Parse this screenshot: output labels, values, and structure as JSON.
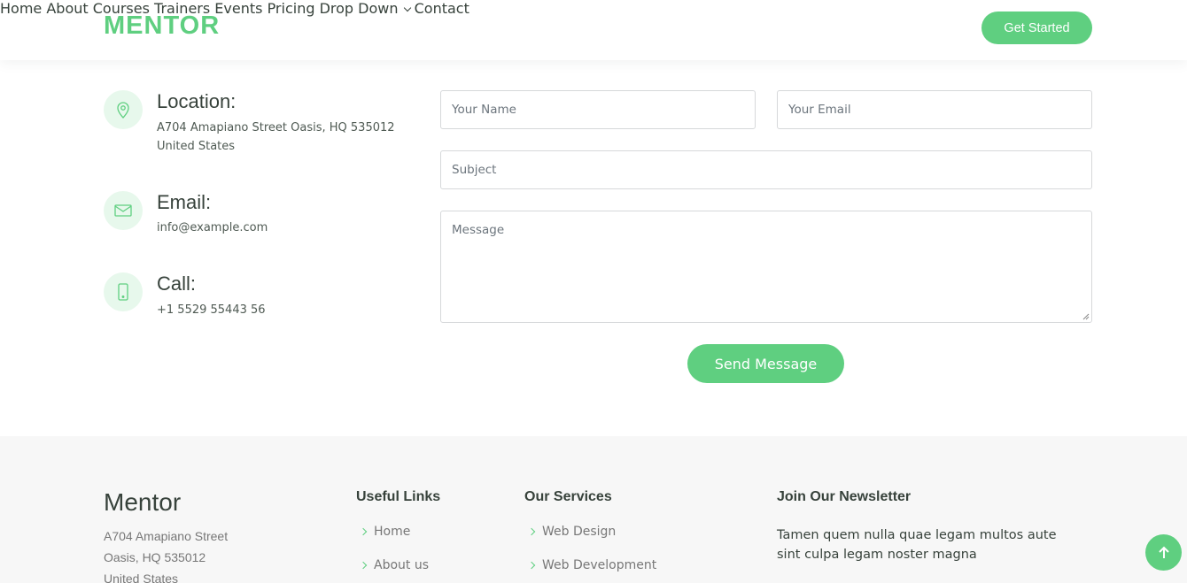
{
  "brand": {
    "logo": "MENTOR"
  },
  "nav": {
    "items": [
      {
        "label": "Home"
      },
      {
        "label": "About"
      },
      {
        "label": "Courses"
      },
      {
        "label": "Trainers"
      },
      {
        "label": "Events"
      },
      {
        "label": "Pricing"
      },
      {
        "label": "Drop Down"
      },
      {
        "label": "Contact"
      }
    ],
    "active": "Contact",
    "cta_label": "Get Started"
  },
  "contact": {
    "location": {
      "title": "Location:",
      "line1": "A704 Amapiano Street Oasis, HQ 535012",
      "line2": "United States",
      "icon": "map-pin-icon"
    },
    "email": {
      "title": "Email:",
      "value": "info@example.com",
      "icon": "envelope-icon"
    },
    "call": {
      "title": "Call:",
      "value": "+1 5529 55443 56",
      "icon": "phone-icon"
    }
  },
  "form": {
    "name_placeholder": "Your Name",
    "email_placeholder": "Your Email",
    "subject_placeholder": "Subject",
    "message_placeholder": "Message",
    "submit_label": "Send Message"
  },
  "footer": {
    "brand": "Mentor",
    "address": [
      "A704 Amapiano Street",
      "Oasis, HQ 535012",
      "United States"
    ],
    "useful_links": {
      "title": "Useful Links",
      "items": [
        "Home",
        "About us"
      ]
    },
    "services": {
      "title": "Our Services",
      "items": [
        "Web Design",
        "Web Development"
      ]
    },
    "newsletter": {
      "title": "Join Our Newsletter",
      "text": "Tamen quem nulla quae legam multos aute sint culpa legam noster magna"
    }
  },
  "colors": {
    "accent": "#5fcf80",
    "text": "#37423b",
    "footer_bg": "#f7f7f7",
    "icon_bg": "#e7f8ec"
  },
  "icons": {
    "back_to_top": "arrow-up-icon",
    "dropdown": "chevron-down-icon",
    "link_bullet": "chevron-right-icon"
  }
}
